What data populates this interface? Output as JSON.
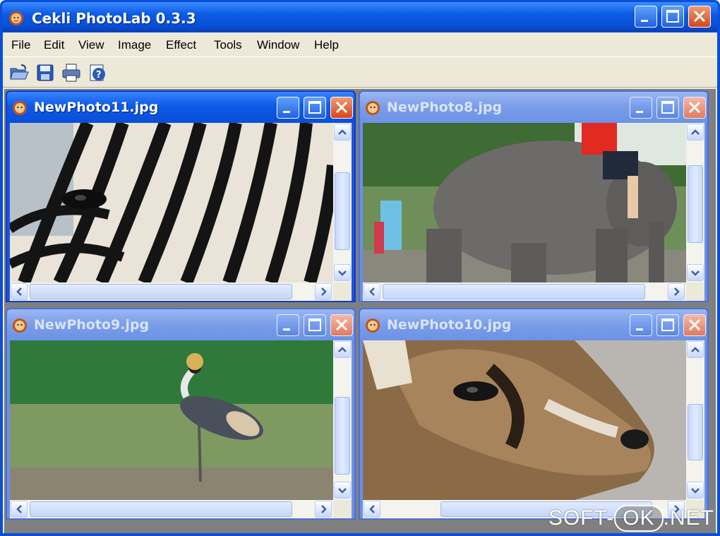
{
  "window": {
    "title": "Cekli PhotoLab 0.3.3",
    "app_icon": "photolab-face-icon"
  },
  "menu": [
    "File",
    "Edit",
    "View",
    "Image",
    "Effect",
    "Tools",
    "Window",
    "Help"
  ],
  "toolbar": [
    "open-folder-icon",
    "save-disk-icon",
    "print-icon",
    "help-icon"
  ],
  "documents": [
    {
      "title": "NewPhoto11.jpg",
      "active": true,
      "subject": "zebra"
    },
    {
      "title": "NewPhoto8.jpg",
      "active": false,
      "subject": "elephant"
    },
    {
      "title": "NewPhoto9.jpg",
      "active": false,
      "subject": "crowned-crane"
    },
    {
      "title": "NewPhoto10.jpg",
      "active": false,
      "subject": "antelope"
    }
  ],
  "watermark": {
    "part1": "SOFT-",
    "part2": "OK",
    "part3": ".NET"
  },
  "colors": {
    "title_bar": "#0a4fd8",
    "inactive_title": "#7a9de9",
    "close_button": "#d6451a",
    "face": "#ece9d8"
  }
}
